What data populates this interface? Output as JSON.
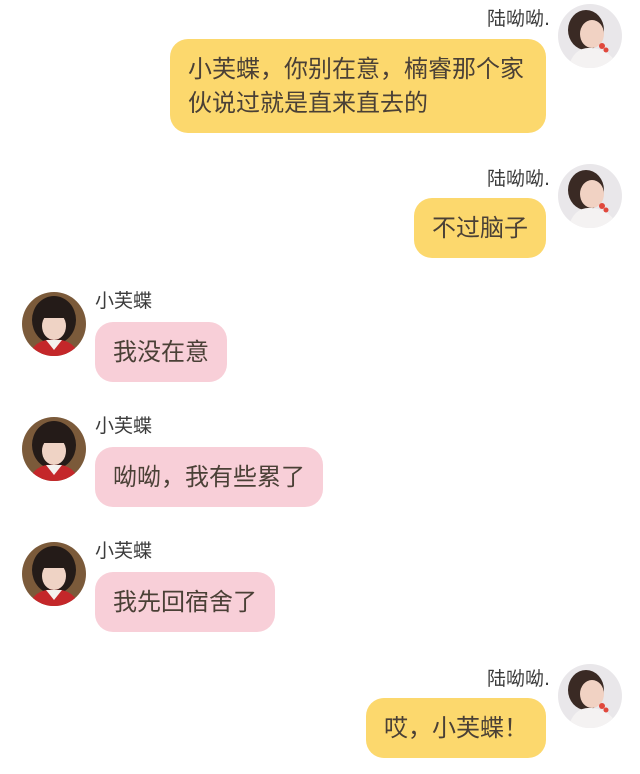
{
  "messages": [
    {
      "side": "right",
      "sender": "陆呦呦.",
      "text": "小芙蝶，你别在意，楠睿那个家伙说过就是直来直去的",
      "avatar": "avatar-girl-white-scarf"
    },
    {
      "side": "right",
      "sender": "陆呦呦.",
      "text": "不过脑子",
      "avatar": "avatar-girl-white-scarf"
    },
    {
      "side": "left",
      "sender": "小芙蝶",
      "text": "我没在意",
      "avatar": "avatar-girl-bangs-red"
    },
    {
      "side": "left",
      "sender": "小芙蝶",
      "text": "呦呦，我有些累了",
      "avatar": "avatar-girl-bangs-red"
    },
    {
      "side": "left",
      "sender": "小芙蝶",
      "text": "我先回宿舍了",
      "avatar": "avatar-girl-bangs-red"
    },
    {
      "side": "right",
      "sender": "陆呦呦.",
      "text": "哎，小芙蝶！",
      "avatar": "avatar-girl-white-scarf"
    }
  ],
  "colors": {
    "right_bubble": "#fcd86d",
    "left_bubble": "#f8cfd8",
    "background": "#ffffff",
    "text": "#4a4036"
  }
}
